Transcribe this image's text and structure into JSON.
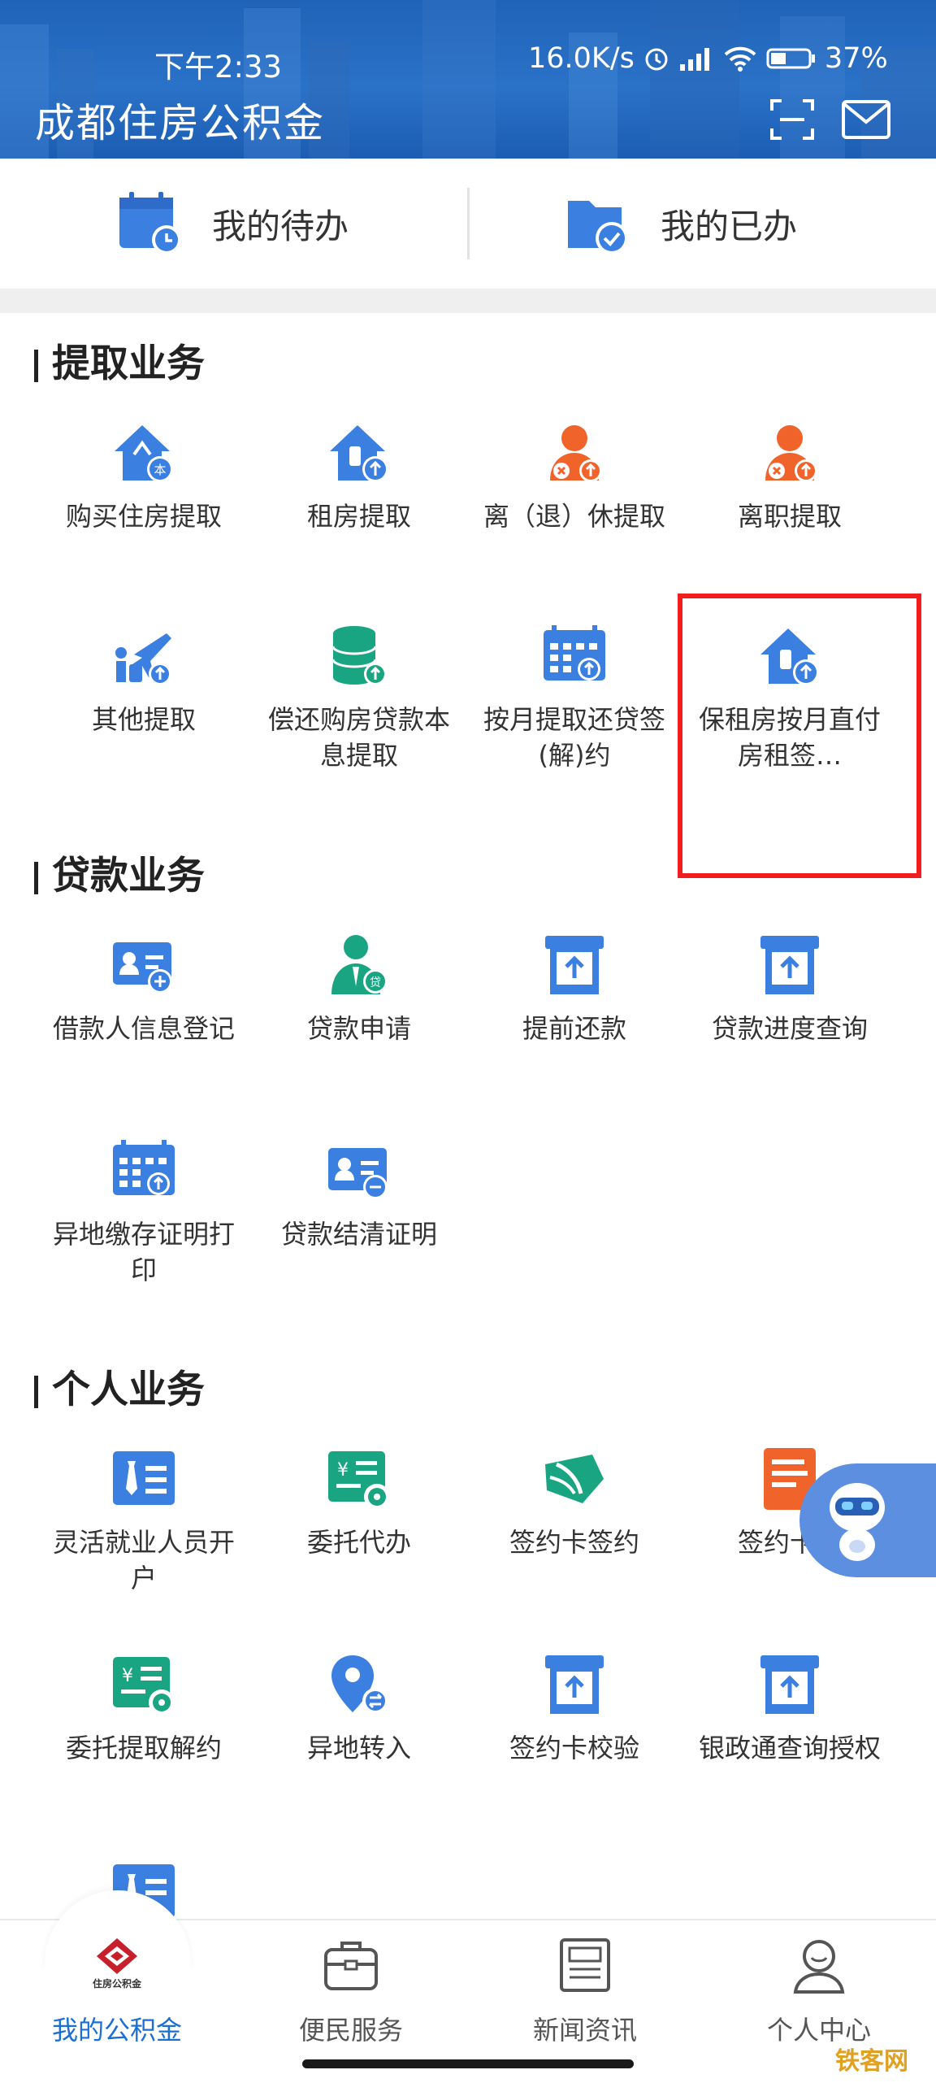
{
  "status_bar": {
    "time": "下午2:33",
    "network_speed": "16.0K/s",
    "battery": "37%"
  },
  "header": {
    "title": "成都住房公积金",
    "scan_icon": "scan-icon",
    "mail_icon": "mail-icon"
  },
  "todo": {
    "pending_label": "我的待办",
    "done_label": "我的已办"
  },
  "sections": {
    "withdraw": {
      "title": "提取业务",
      "items": [
        {
          "label": "购买住房提取",
          "icon": "house-purchase-icon"
        },
        {
          "label": "租房提取",
          "icon": "house-rent-icon"
        },
        {
          "label": "离（退）休提取",
          "icon": "retire-icon"
        },
        {
          "label": "离职提取",
          "icon": "resign-icon"
        },
        {
          "label": "其他提取",
          "icon": "travel-icon"
        },
        {
          "label": "偿还购房贷款本息提取",
          "icon": "coin-stack-icon"
        },
        {
          "label": "按月提取还贷签(解)约",
          "icon": "calendar-icon"
        },
        {
          "label": "保租房按月直付房租签…",
          "icon": "rental-house-icon"
        }
      ]
    },
    "loan": {
      "title": "贷款业务",
      "items": [
        {
          "label": "借款人信息登记",
          "icon": "id-card-plus-icon"
        },
        {
          "label": "贷款申请",
          "icon": "person-loan-icon"
        },
        {
          "label": "提前还款",
          "icon": "upload-box-icon"
        },
        {
          "label": "贷款进度查询",
          "icon": "upload-box-icon"
        },
        {
          "label": "异地缴存证明打印",
          "icon": "calendar-icon"
        },
        {
          "label": "贷款结清证明",
          "icon": "id-card-plus-icon"
        }
      ]
    },
    "personal": {
      "title": "个人业务",
      "items": [
        {
          "label": "灵活就业人员开户",
          "icon": "tie-card-icon"
        },
        {
          "label": "委托代办",
          "icon": "yuan-gear-icon"
        },
        {
          "label": "签约卡签约",
          "icon": "leaf-card-icon"
        },
        {
          "label": "签约卡解",
          "icon": "document-icon"
        },
        {
          "label": "委托提取解约",
          "icon": "yuan-gear-icon"
        },
        {
          "label": "异地转入",
          "icon": "location-transfer-icon"
        },
        {
          "label": "签约卡校验",
          "icon": "upload-box-icon"
        },
        {
          "label": "银政通查询授权",
          "icon": "upload-box-icon"
        }
      ]
    }
  },
  "bottom_nav": [
    {
      "label": "我的公积金",
      "icon": "housing-fund-logo-icon",
      "logo_text": "住房公积金"
    },
    {
      "label": "便民服务",
      "icon": "briefcase-icon"
    },
    {
      "label": "新闻资讯",
      "icon": "news-icon"
    },
    {
      "label": "个人中心",
      "icon": "person-icon"
    }
  ],
  "watermark": "铁客网",
  "colors": {
    "primary_blue": "#3b7fe0",
    "accent_green": "#1aa582",
    "accent_orange": "#f0632a",
    "active_nav": "#1a6fd6"
  }
}
